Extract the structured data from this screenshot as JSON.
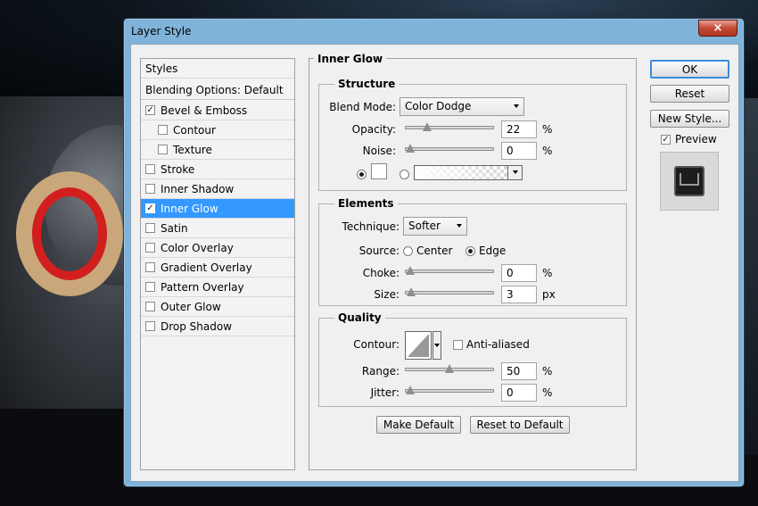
{
  "window": {
    "title": "Layer Style",
    "close_glyph": "×"
  },
  "left_panel": {
    "styles_header": "Styles",
    "blending_options": "Blending Options: Default",
    "items": [
      {
        "label": "Bevel & Emboss",
        "checked": true,
        "indent": false
      },
      {
        "label": "Contour",
        "checked": false,
        "indent": true
      },
      {
        "label": "Texture",
        "checked": false,
        "indent": true
      },
      {
        "label": "Stroke",
        "checked": false,
        "indent": false
      },
      {
        "label": "Inner Shadow",
        "checked": false,
        "indent": false
      },
      {
        "label": "Inner Glow",
        "checked": true,
        "indent": false,
        "selected": true
      },
      {
        "label": "Satin",
        "checked": false,
        "indent": false
      },
      {
        "label": "Color Overlay",
        "checked": false,
        "indent": false
      },
      {
        "label": "Gradient Overlay",
        "checked": false,
        "indent": false
      },
      {
        "label": "Pattern Overlay",
        "checked": false,
        "indent": false
      },
      {
        "label": "Outer Glow",
        "checked": false,
        "indent": false
      },
      {
        "label": "Drop Shadow",
        "checked": false,
        "indent": false
      }
    ]
  },
  "inner_glow": {
    "title": "Inner Glow",
    "structure": {
      "title": "Structure",
      "blend_mode_label": "Blend Mode:",
      "blend_mode_value": "Color Dodge",
      "opacity_label": "Opacity:",
      "opacity_value": "22",
      "opacity_level": 22,
      "opacity_unit": "%",
      "noise_label": "Noise:",
      "noise_value": "0",
      "noise_level": 0,
      "noise_unit": "%",
      "color_mode": "solid",
      "glow_color": "#ffffff"
    },
    "elements": {
      "title": "Elements",
      "technique_label": "Technique:",
      "technique_value": "Softer",
      "source_label": "Source:",
      "source_center": "Center",
      "source_edge": "Edge",
      "source_selected": "Edge",
      "choke_label": "Choke:",
      "choke_value": "0",
      "choke_level": 0,
      "choke_unit": "%",
      "size_label": "Size:",
      "size_value": "3",
      "size_level": 3,
      "size_unit": "px"
    },
    "quality": {
      "title": "Quality",
      "contour_label": "Contour:",
      "anti_aliased_label": "Anti-aliased",
      "anti_aliased": false,
      "range_label": "Range:",
      "range_value": "50",
      "range_level": 50,
      "range_unit": "%",
      "jitter_label": "Jitter:",
      "jitter_value": "0",
      "jitter_level": 0,
      "jitter_unit": "%"
    },
    "make_default": "Make Default",
    "reset_to_default": "Reset to Default"
  },
  "actions": {
    "ok": "OK",
    "reset": "Reset",
    "new_style": "New Style...",
    "preview_label": "Preview",
    "preview_checked": true
  },
  "colors": {
    "selection": "#3399ff",
    "window_frame": "#7fb3d9",
    "close_button": "#c44a35"
  }
}
